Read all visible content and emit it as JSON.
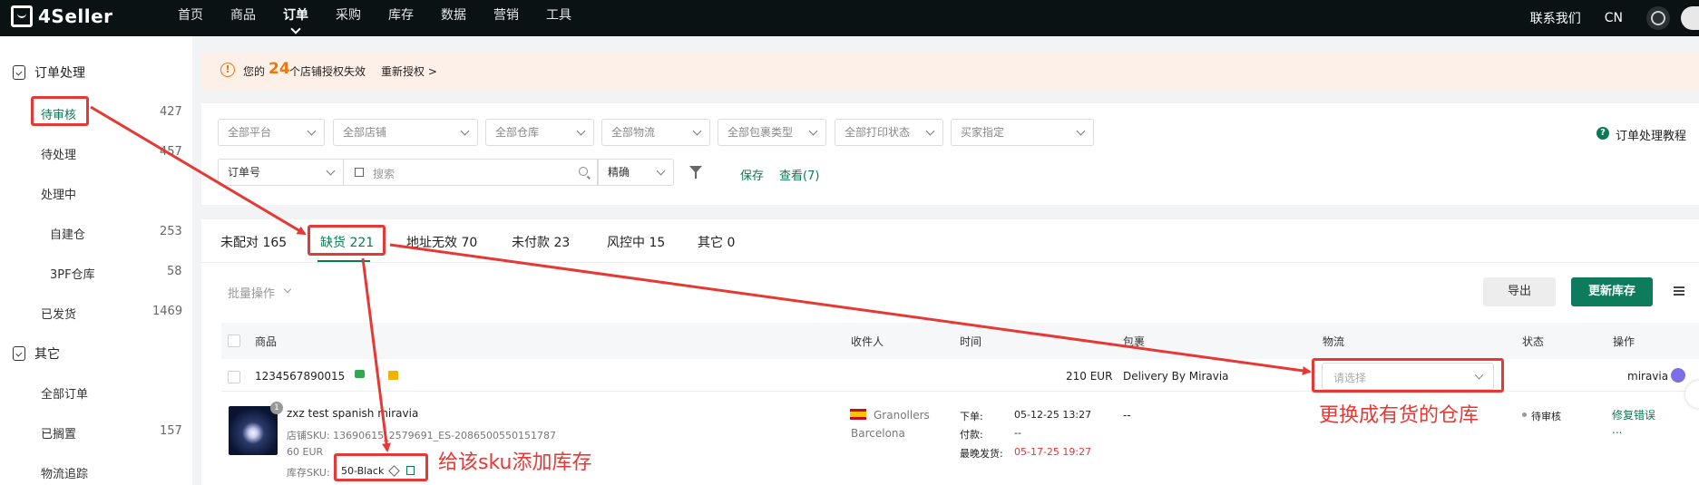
{
  "app": {
    "name": "4Seller"
  },
  "nav": [
    "首页",
    "商品",
    "订单",
    "采购",
    "库存",
    "数据",
    "营销",
    "工具"
  ],
  "nav_active_index": 2,
  "top_right": {
    "contact": "联系我们",
    "lang": "CN"
  },
  "sidebar": {
    "group1": "订单处理",
    "items1": [
      {
        "label": "待审核",
        "count": "427"
      },
      {
        "label": "待处理",
        "count": "457"
      },
      {
        "label": "处理中",
        "count": ""
      },
      {
        "label": "自建仓",
        "count": "253"
      },
      {
        "label": "3PF仓库",
        "count": "58"
      },
      {
        "label": "已发货",
        "count": "1469"
      }
    ],
    "group2": "其它",
    "items2": [
      {
        "label": "全部订单",
        "count": ""
      },
      {
        "label": "已搁置",
        "count": "157"
      },
      {
        "label": "物流追踪",
        "count": ""
      }
    ]
  },
  "notice": {
    "prefix": "您的",
    "count": "24",
    "suffix": "个店铺授权失效",
    "action": "重新授权 >"
  },
  "filters": {
    "row1": [
      "全部平台",
      "全部店铺",
      "全部仓库",
      "全部物流",
      "全部包裹类型",
      "全部打印状态",
      "买家指定"
    ],
    "order_field": "订单号",
    "search_placeholder": "搜索",
    "match": "精确",
    "save": "保存",
    "view": "查看(7)",
    "help": "订单处理教程"
  },
  "tabs": [
    {
      "label": "未配对 165"
    },
    {
      "label": "缺货 221"
    },
    {
      "label": "地址无效 70"
    },
    {
      "label": "未付款 23"
    },
    {
      "label": "风控中 15"
    },
    {
      "label": "其它 0"
    }
  ],
  "tabs_active_index": 1,
  "toolbar": {
    "batch": "批量操作",
    "export": "导出",
    "update_stock": "更新库存"
  },
  "table": {
    "headers": [
      "商品",
      "收件人",
      "时间",
      "包裹",
      "物流",
      "状态",
      "操作"
    ],
    "order": {
      "order_no": "1234567890015",
      "amount": "210 EUR",
      "package": "Delivery By Miravia",
      "logistics_placeholder": "请选择",
      "platform": "miravia"
    },
    "item": {
      "qty": "1",
      "title": "zxz test spanish miravia",
      "store_sku": "店铺SKU: 13690615_2579691_ES-2086500550151787",
      "price": "60 EUR",
      "stock_sku_label": "库存SKU:",
      "stock_sku": "50-Black",
      "recipient_city": "Granollers",
      "recipient_region": "Barcelona",
      "time_order_label": "下单:",
      "time_order": "05-12-25 13:27",
      "time_paid_label": "付款:",
      "time_paid": "--",
      "time_ship_label": "最晚发货:",
      "time_ship": "05-17-25 19:27",
      "package": "--",
      "status": "待审核",
      "action": "修复错误",
      "more": "..."
    }
  },
  "annotations": {
    "sku_tip": "给该sku添加库存",
    "warehouse_tip": "更换成有货的仓库"
  },
  "colors": {
    "accent": "#0a7a55",
    "annotation": "#e53935",
    "warning": "#e8790f"
  }
}
